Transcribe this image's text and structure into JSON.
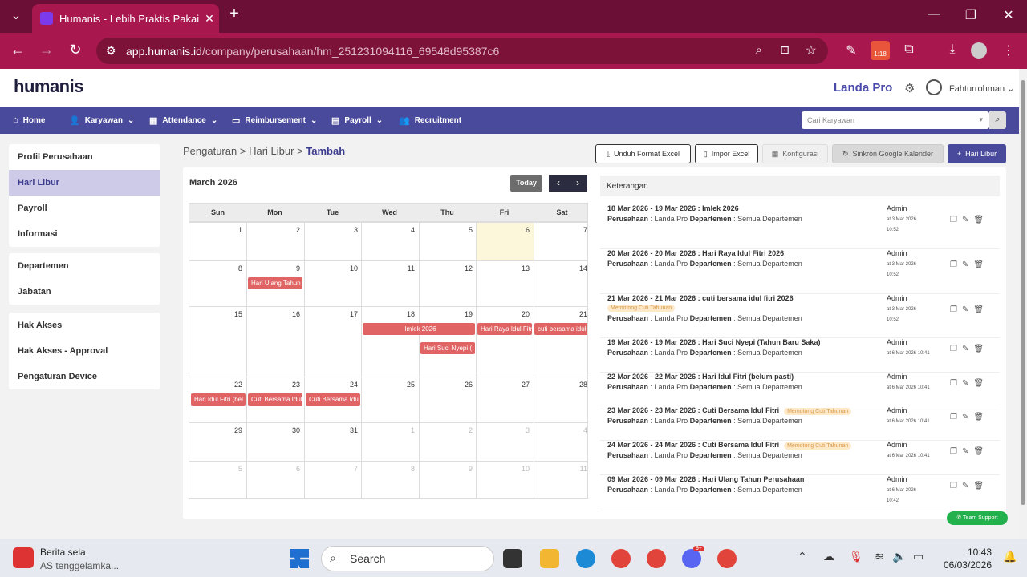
{
  "browser": {
    "tab_title": "Humanis - Lebih Praktis Pakai H",
    "url_domain": "app.humanis.id",
    "url_path": "/company/perusahaan/hm_251231094116_69548d95387c6",
    "badge": "1:18"
  },
  "header": {
    "logo": "humanis",
    "company": "Landa Pro",
    "user": "Fahturrohman"
  },
  "nav": {
    "items": [
      "Home",
      "Karyawan",
      "Attendance",
      "Reimbursement",
      "Payroll",
      "Recruitment"
    ],
    "search_placeholder": "Cari Karyawan"
  },
  "sidebar": {
    "group1": [
      "Profil Perusahaan",
      "Hari Libur",
      "Payroll",
      "Informasi"
    ],
    "group2": [
      "Departemen",
      "Jabatan"
    ],
    "group3": [
      "Hak Akses",
      "Hak Akses - Approval",
      "Pengaturan Device"
    ],
    "active": "Hari Libur"
  },
  "breadcrumb": {
    "a": "Pengaturan",
    "b": "Hari Libur",
    "c": "Tambah",
    "sep": ">"
  },
  "actions": {
    "unduh": "Unduh Format Excel",
    "impor": "Impor Excel",
    "konfigurasi": "Konfigurasi",
    "sinkron": "Sinkron Google Kalender",
    "tambah": "Hari Libur"
  },
  "calendar": {
    "month": "March 2026",
    "today": "Today",
    "days": [
      "Sun",
      "Mon",
      "Tue",
      "Wed",
      "Thu",
      "Fri",
      "Sat"
    ],
    "weeks": [
      [
        "1",
        "2",
        "3",
        "4",
        "5",
        "6",
        "7"
      ],
      [
        "8",
        "9",
        "10",
        "11",
        "12",
        "13",
        "14"
      ],
      [
        "15",
        "16",
        "17",
        "18",
        "19",
        "20",
        "21"
      ],
      [
        "22",
        "23",
        "24",
        "25",
        "26",
        "27",
        "28"
      ],
      [
        "29",
        "30",
        "31",
        "1",
        "2",
        "3",
        "4"
      ],
      [
        "5",
        "6",
        "7",
        "8",
        "9",
        "10",
        "11"
      ]
    ],
    "events": {
      "e1": "Hari Ulang Tahun",
      "e2": "Imlek 2026",
      "e3": "Hari Raya Idul Fitri",
      "e4": "cuti bersama idul fitri",
      "e5": "Hari Suci Nyepi (",
      "e6": "Hari Idul Fitri (bel",
      "e7": "Cuti Bersama Idul",
      "e8": "Cuti Bersama Idul"
    }
  },
  "list": {
    "header": "Keterangan",
    "perusahaan_label": "Perusahaan",
    "departemen_label": "Departemen",
    "company": ": Landa Pro",
    "dept": ": Semua Departemen",
    "admin": "Admin",
    "items": [
      {
        "title": "18 Mar 2026 - 19 Mar 2026 : Imlek 2026",
        "tag": "",
        "at1": "at 3 Mar 2026",
        "at2": "10:52"
      },
      {
        "title": "20 Mar 2026 - 20 Mar 2026 : Hari Raya Idul Fitri 2026",
        "tag": "",
        "at1": "at 3 Mar 2026",
        "at2": "10:52"
      },
      {
        "title": "21 Mar 2026 - 21 Mar 2026 : cuti bersama idul fitri 2026",
        "tag": "Memotong Cuti Tahunan",
        "at1": "at 3 Mar 2026",
        "at2": "10:52"
      },
      {
        "title": "19 Mar 2026 - 19 Mar 2026 : Hari Suci Nyepi (Tahun Baru Saka)",
        "tag": "",
        "at1": "at 6 Mar 2026 10:41",
        "at2": ""
      },
      {
        "title": "22 Mar 2026 - 22 Mar 2026 : Hari Idul Fitri (belum pasti)",
        "tag": "",
        "at1": "at 6 Mar 2026 10:41",
        "at2": ""
      },
      {
        "title": "23 Mar 2026 - 23 Mar 2026 : Cuti Bersama Idul Fitri",
        "tag": "Memotong Cuti Tahunan",
        "at1": "at 6 Mar 2026 10:41",
        "at2": ""
      },
      {
        "title": "24 Mar 2026 - 24 Mar 2026 : Cuti Bersama Idul Fitri",
        "tag": "Memotong Cuti Tahunan",
        "at1": "at 6 Mar 2026 10:41",
        "at2": ""
      },
      {
        "title": "09 Mar 2026 - 09 Mar 2026 : Hari Ulang Tahun Perusahaan",
        "tag": "",
        "at1": "at 6 Mar 2026",
        "at2": "10:42"
      }
    ]
  },
  "support": "Team Support",
  "taskbar": {
    "news_title": "Berita sela",
    "news_sub": "AS tenggelamka...",
    "search": "Search",
    "time": "10:43",
    "date": "06/03/2026",
    "badge": "9+"
  }
}
